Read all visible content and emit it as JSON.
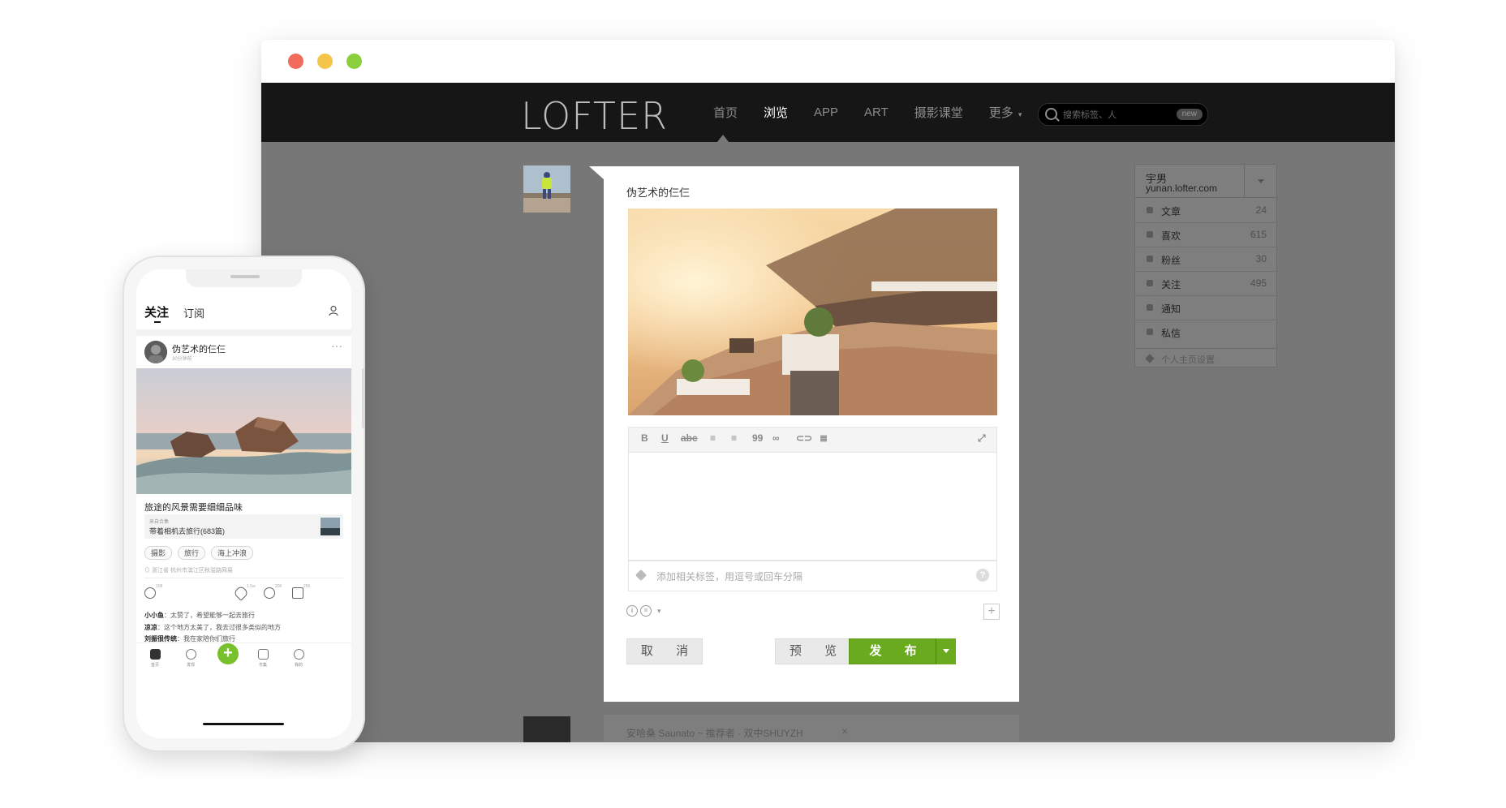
{
  "browser": {
    "logo": "LOFTER",
    "nav": [
      {
        "label": "首页",
        "active": false
      },
      {
        "label": "浏览",
        "active": true
      },
      {
        "label": "APP",
        "active": false
      },
      {
        "label": "ART",
        "active": false
      },
      {
        "label": "摄影课堂",
        "active": false
      },
      {
        "label": "更多",
        "active": false
      }
    ],
    "search": {
      "placeholder": "搜索标签、人",
      "badge": "new"
    }
  },
  "editor": {
    "post_title": "伪艺术的仨仨",
    "toolbar": [
      "B",
      "U",
      "abc",
      "≡",
      "≡",
      "99",
      "∞",
      "⊂⊃",
      "≣",
      "⤢"
    ],
    "tags_placeholder": "添加相关标签，用逗号或回车分隔",
    "help": "?",
    "cancel": "取 消",
    "preview": "预 览",
    "publish": "发 布"
  },
  "sidebar": {
    "name": "宇男",
    "domain": "yunan.lofter.com",
    "items": [
      {
        "label": "文章",
        "count": "24",
        "icon": "article-icon"
      },
      {
        "label": "喜欢",
        "count": "615",
        "icon": "heart-icon"
      },
      {
        "label": "粉丝",
        "count": "30",
        "icon": "person-icon"
      },
      {
        "label": "关注",
        "count": "495",
        "icon": "eye-icon"
      },
      {
        "label": "通知",
        "count": "",
        "icon": "speaker-icon"
      },
      {
        "label": "私信",
        "count": "",
        "icon": "mail-icon"
      }
    ],
    "settings": "个人主页设置"
  },
  "next_post": {
    "text": "安哈桑 Saunato ~ 推荐者 · 双中SHUYZH",
    "close": "×"
  },
  "phone": {
    "tabs": {
      "follow": "关注",
      "subscribe": "订阅"
    },
    "post": {
      "author": "伪艺术的仨仨",
      "time": "30分钟前",
      "more": "···",
      "title": "旅途的风景需要细细品味",
      "collection_label": "来自合集",
      "collection_name": "带着相机去旅行(683篇)",
      "tags": [
        "摄影",
        "旅行",
        "海上冲浪"
      ],
      "location": "浙江省 杭州市滨江区秋溢路网易",
      "counts": {
        "hot": "108",
        "like": "1.5w",
        "comment": "206",
        "recommend": "256"
      },
      "comments": [
        {
          "user": "小小鱼",
          "text": "太赞了，希望能够一起去旅行"
        },
        {
          "user": "凉凉",
          "text": "这个地方太美了，我去过很多类似的地方"
        },
        {
          "user": "刘振很传统",
          "text": "我在家陪你们旅行"
        }
      ]
    },
    "tabbar": [
      {
        "label": "首页",
        "icon": "home-icon"
      },
      {
        "label": "发现",
        "icon": "discover-icon"
      },
      {
        "label": "",
        "icon": "plus-icon"
      },
      {
        "label": "市集",
        "icon": "market-icon"
      },
      {
        "label": "我的",
        "icon": "profile-icon"
      }
    ],
    "accent": "#78c02c"
  },
  "colors": {
    "publish": "#6aaa1f",
    "nav_bg": "#161616",
    "overlay": "#777777"
  }
}
